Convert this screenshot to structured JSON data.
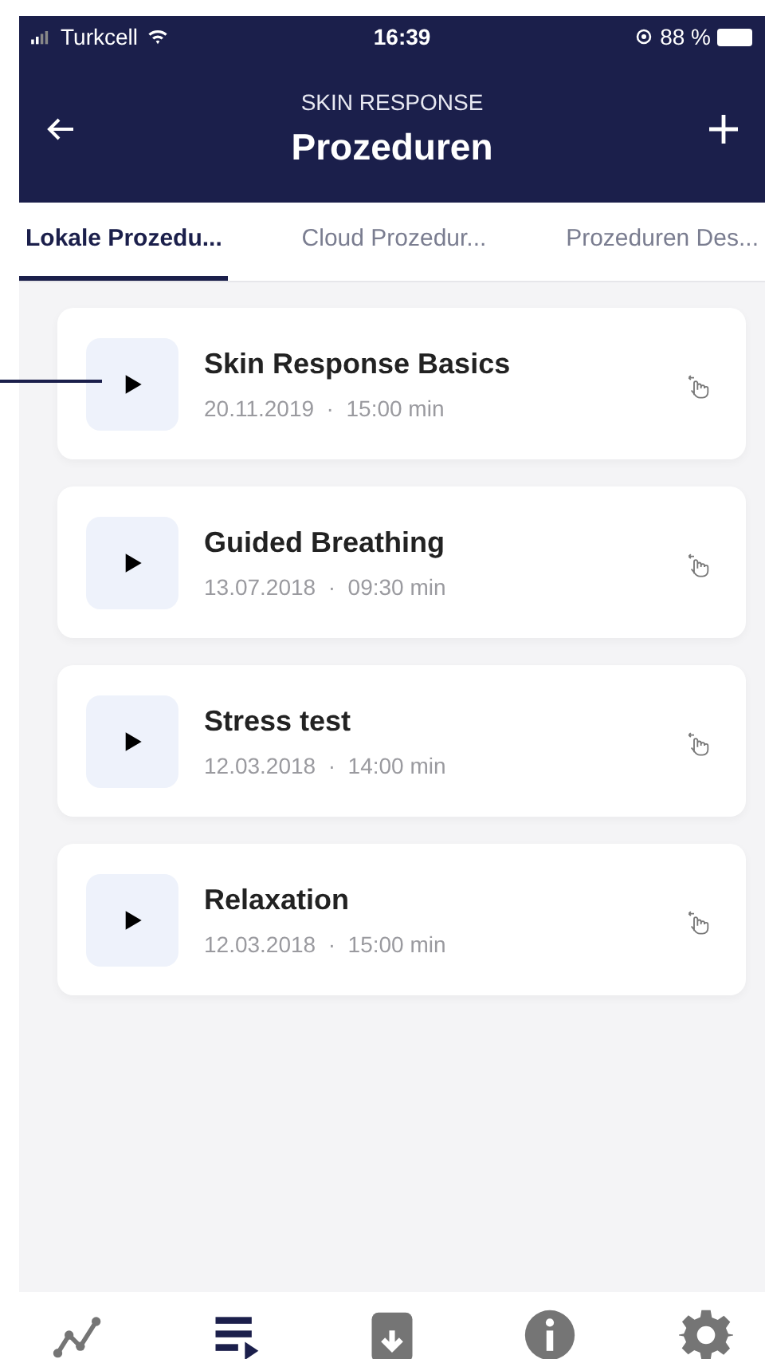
{
  "status_bar": {
    "carrier": "Turkcell",
    "time": "16:39",
    "battery": "88 %"
  },
  "header": {
    "subtitle": "SKIN RESPONSE",
    "title": "Prozeduren"
  },
  "tabs": [
    {
      "label": "Lokale Prozedu...",
      "selected": true
    },
    {
      "label": "Cloud Prozedur...",
      "selected": false
    },
    {
      "label": "Prozeduren Des...",
      "selected": false
    }
  ],
  "procedures": [
    {
      "name": "Skin Response Basics",
      "date": "20.11.2019",
      "separator": "·",
      "duration": "15:00 min"
    },
    {
      "name": "Guided Breathing",
      "date": "13.07.2018",
      "separator": "·",
      "duration": "09:30 min"
    },
    {
      "name": "Stress test",
      "date": "12.03.2018",
      "separator": "·",
      "duration": "14:00 min"
    },
    {
      "name": "Relaxation",
      "date": "12.03.2018",
      "separator": "·",
      "duration": "15:00 min"
    }
  ],
  "bottom_nav": [
    {
      "kind": "chart",
      "selected": false
    },
    {
      "kind": "playlist",
      "selected": true
    },
    {
      "kind": "archive",
      "selected": false
    },
    {
      "kind": "info",
      "selected": false
    },
    {
      "kind": "settings",
      "selected": false
    }
  ]
}
